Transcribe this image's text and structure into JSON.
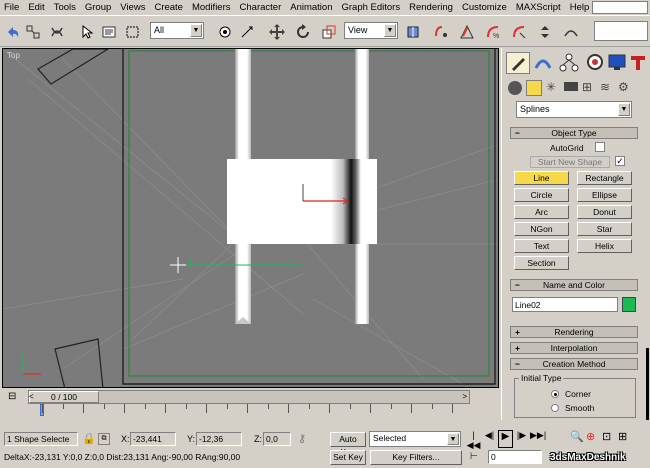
{
  "menu": [
    "File",
    "Edit",
    "Tools",
    "Group",
    "Views",
    "Create",
    "Modifiers",
    "Character",
    "Animation",
    "Graph Editors",
    "Rendering",
    "Customize",
    "MAXScript",
    "Help"
  ],
  "toolbar": {
    "selection_filter": "All",
    "ref_coord": "View"
  },
  "viewport": {
    "label": "Top"
  },
  "command_panel": {
    "category_dropdown": "Splines",
    "object_type": {
      "title": "Object Type",
      "sign": "−",
      "autogrid": "AutoGrid",
      "start_new_shape": "Start New Shape",
      "buttons": [
        "Line",
        "Rectangle",
        "Circle",
        "Ellipse",
        "Arc",
        "Donut",
        "NGon",
        "Star",
        "Text",
        "Helix",
        "Section"
      ]
    },
    "name_color": {
      "title": "Name and Color",
      "sign": "−",
      "name": "Line02",
      "color": "#1db954"
    },
    "rendering": {
      "title": "Rendering",
      "sign": "+"
    },
    "interpolation": {
      "title": "Interpolation",
      "sign": "+"
    },
    "creation_method": {
      "title": "Creation Method",
      "sign": "−",
      "initial_type": "Initial Type",
      "options": [
        "Corner",
        "Smooth"
      ]
    }
  },
  "timeline": {
    "frame_display": "0 / 100",
    "ticks": [
      "0",
      "10",
      "20",
      "30",
      "40",
      "50",
      "60",
      "70",
      "80",
      "90",
      "100"
    ]
  },
  "status": {
    "selected": "1 Shape Selecte",
    "x_label": "X:",
    "x": "-23,441",
    "y_label": "Y:",
    "y": "-12,36",
    "z_label": "Z:",
    "z": "0,0",
    "prompt": "DeltaX:-23,131  Y:0,0  Z:0,0  Dist:23,131  Ang:-90,00  RAng:90,00",
    "auto_key": "Auto Key",
    "set_key": "Set Key",
    "key_mode": "Selected",
    "key_filters": "Key Filters...",
    "frame": "0",
    "watermark": "3dsMaxDeshnik"
  }
}
